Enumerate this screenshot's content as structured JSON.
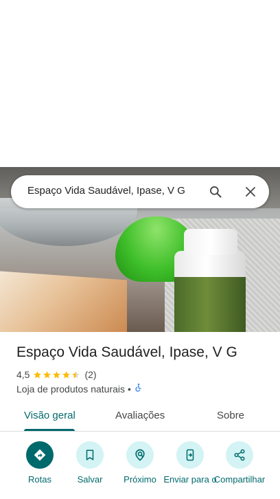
{
  "search": {
    "query": "Espaço Vida Saudável, Ipase, V G"
  },
  "place": {
    "name": "Espaço Vida Saudável, Ipase, V G",
    "rating": "4,5",
    "stars_value": 4.5,
    "review_count": "(2)",
    "category": "Loja de produtos naturais",
    "separator": "•"
  },
  "tabs": [
    {
      "label": "Visão geral",
      "active": true
    },
    {
      "label": "Avaliações",
      "active": false
    },
    {
      "label": "Sobre",
      "active": false
    }
  ],
  "actions": [
    {
      "label": "Rotas",
      "icon": "directions-icon"
    },
    {
      "label": "Salvar",
      "icon": "bookmark-icon"
    },
    {
      "label": "Próximo",
      "icon": "nearby-icon"
    },
    {
      "label": "Enviar para o",
      "icon": "send-to-phone-icon"
    },
    {
      "label": "Compartilhar",
      "icon": "share-icon"
    }
  ],
  "colors": {
    "accent": "#00696b",
    "accent_light": "#d3f3f4",
    "star": "#fbbc04",
    "accessibility": "#1a73e8"
  }
}
